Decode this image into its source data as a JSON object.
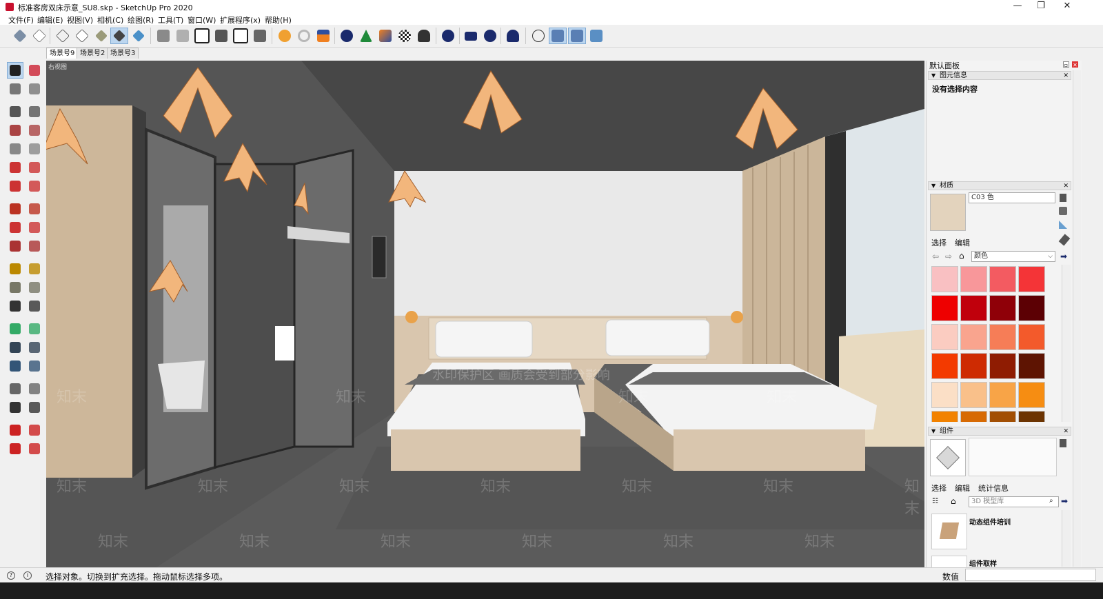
{
  "window": {
    "title": "标准客房双床示意_SU8.skp - SketchUp Pro 2020",
    "controls": {
      "minimize": "—",
      "restore": "❐",
      "close": "✕"
    }
  },
  "menu": [
    "文件(F)",
    "编辑(E)",
    "视图(V)",
    "相机(C)",
    "绘图(R)",
    "工具(T)",
    "窗口(W)",
    "扩展程序(x)",
    "帮助(H)"
  ],
  "scenes": {
    "tabs": [
      "场景号9",
      "场景号2",
      "场景号3"
    ],
    "active": 0
  },
  "viewport": {
    "view_label": "右视图",
    "watermark_banner": "水印保护区  画质会受到部分影响",
    "watermark_text": "知末"
  },
  "status": {
    "message": "选择对象。切换到扩充选择。拖动鼠标选择多项。",
    "measure_label": "数值",
    "measure_value": ""
  },
  "tray": {
    "title": "默认面板",
    "entity_info": {
      "header": "图元信息",
      "body": "没有选择内容"
    },
    "materials": {
      "header": "材质",
      "material_name": "C03 色",
      "tabs": [
        "选择",
        "编辑"
      ],
      "library": "颜色",
      "preview_color": "#e3d3bd",
      "swatches": [
        "#f9c0c2",
        "#f8979a",
        "#f35b61",
        "#f43437",
        "#ee0000",
        "#c0000c",
        "#8f0008",
        "#5c0004",
        "#fbccc1",
        "#f9a48e",
        "#f67d57",
        "#f35a2b",
        "#f33a00",
        "#ce2b02",
        "#8f1c02",
        "#5e1402",
        "#fbdfc6",
        "#f9c08a",
        "#f8a447",
        "#f68d12",
        "#f28200",
        "#d76a04",
        "#a24f04",
        "#6c3402"
      ]
    },
    "components": {
      "header": "组件",
      "tabs": [
        "选择",
        "编辑",
        "统计信息"
      ],
      "search_placeholder": "3D 模型库",
      "items": [
        "动态组件培训",
        "组件取样"
      ]
    }
  },
  "colors": {
    "accent": "#bcd6ef",
    "viewport_ceiling": "#4b4b4b",
    "floor": "#5c5c5c"
  }
}
